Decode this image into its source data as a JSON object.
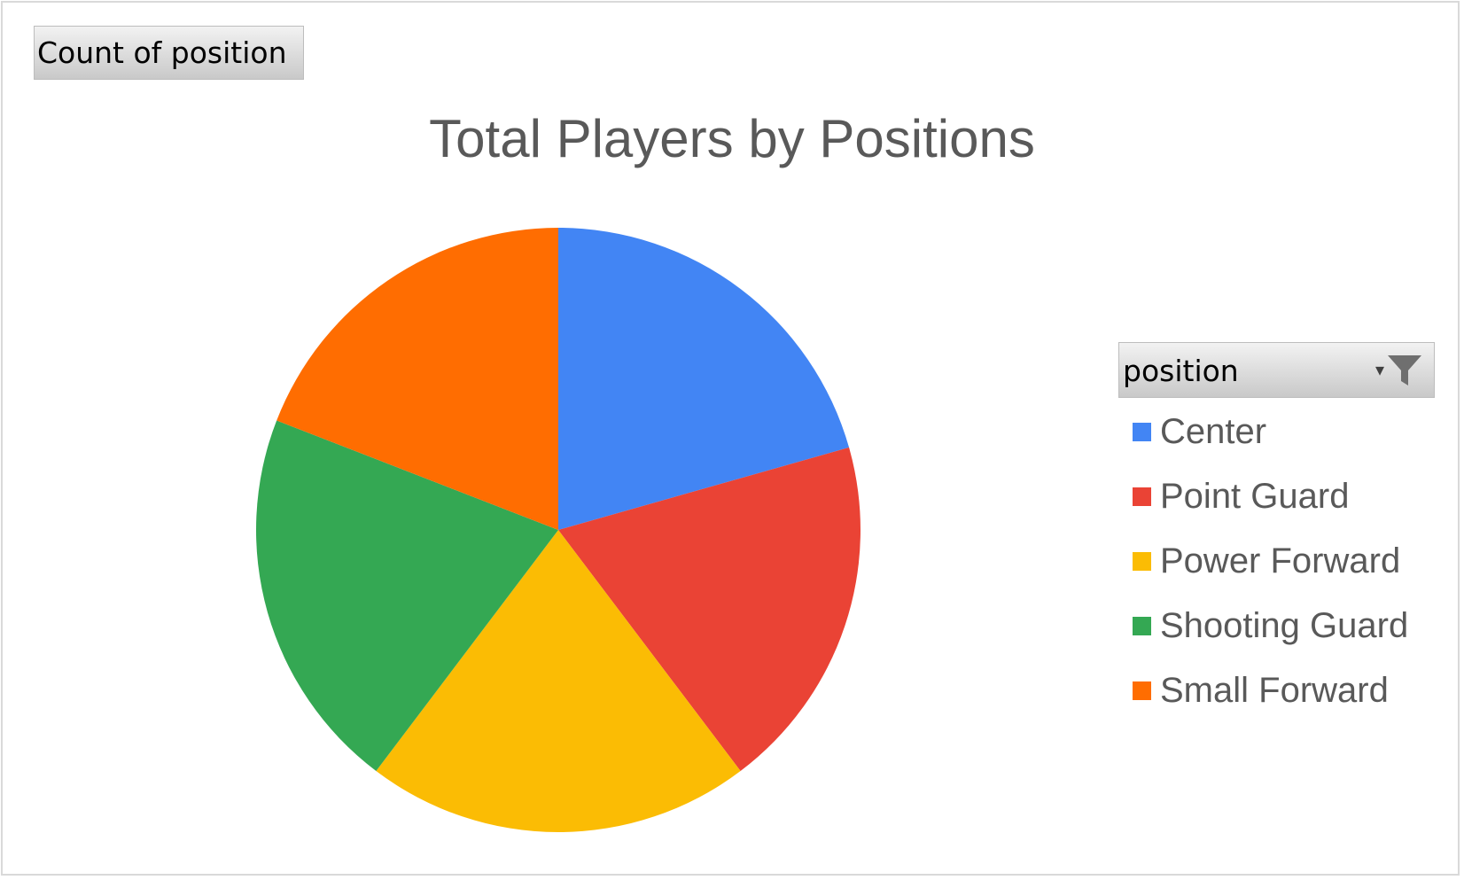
{
  "field_button": {
    "label": "Count of position"
  },
  "legend_filter": {
    "label": "position",
    "dropdown_icon": "chevron-down-icon",
    "filter_icon": "funnel-icon"
  },
  "chart_data": {
    "type": "pie",
    "title": "Total Players by Positions",
    "categories": [
      "Center",
      "Point Guard",
      "Power Forward",
      "Shooting Guard",
      "Small Forward"
    ],
    "values": [
      20.6,
      19.1,
      20.6,
      20.6,
      19.1
    ],
    "colors": [
      "#4285f4",
      "#ea4335",
      "#fbbc04",
      "#34a853",
      "#ff6d01"
    ],
    "legend_position": "right",
    "start_angle": "top",
    "direction": "clockwise"
  }
}
